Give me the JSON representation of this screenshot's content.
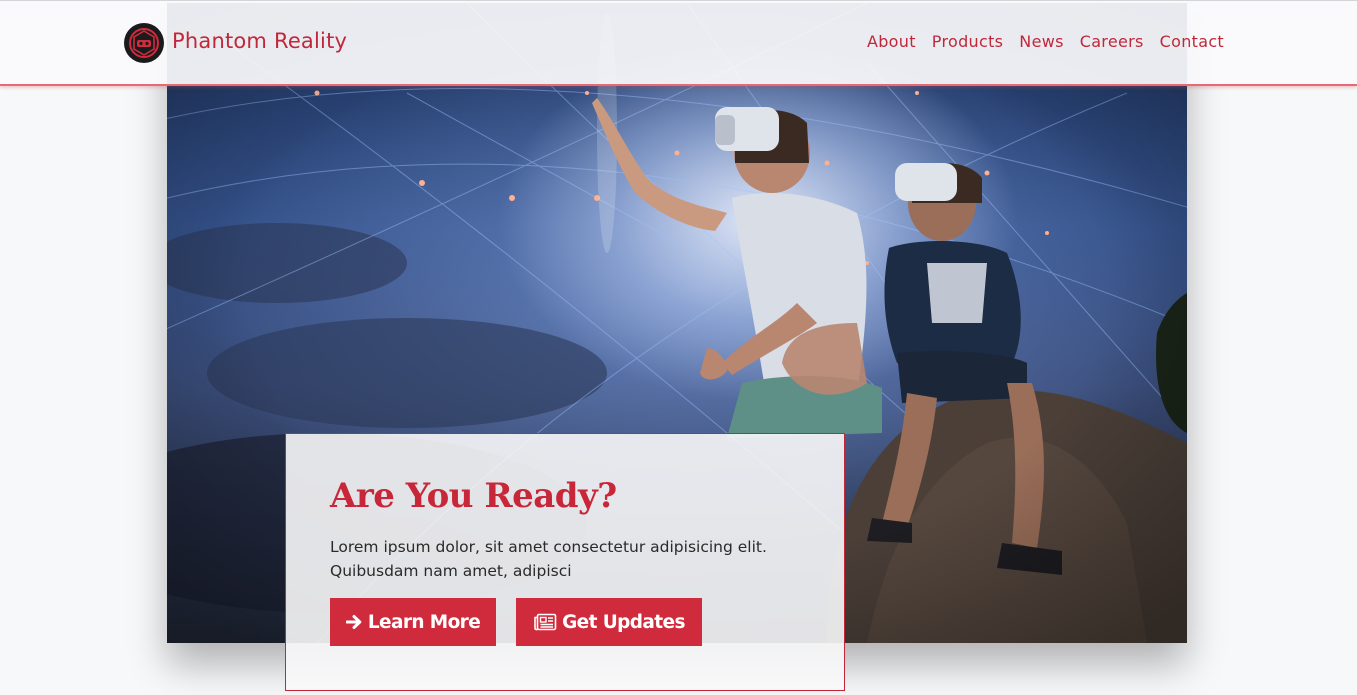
{
  "brand": {
    "name": "Phantom Reality",
    "logo_icon": "vr-headset-logo-icon"
  },
  "nav": {
    "items": [
      {
        "label": "About"
      },
      {
        "label": "Products"
      },
      {
        "label": "News"
      },
      {
        "label": "Careers"
      },
      {
        "label": "Contact"
      }
    ]
  },
  "hero": {
    "image_description_icon": "vr-hero-image"
  },
  "cta": {
    "title": "Are You Ready?",
    "body": "Lorem ipsum dolor, sit amet consectetur adipisicing elit. Quibusdam nam amet, adipisci",
    "learn_more_label": "Learn More",
    "learn_more_icon": "arrow-right-icon",
    "get_updates_label": "Get Updates",
    "get_updates_icon": "newspaper-icon"
  },
  "colors": {
    "accent": "#d02b3c",
    "text_dark": "#2a2a2a",
    "page_bg": "#f7f8fa"
  }
}
